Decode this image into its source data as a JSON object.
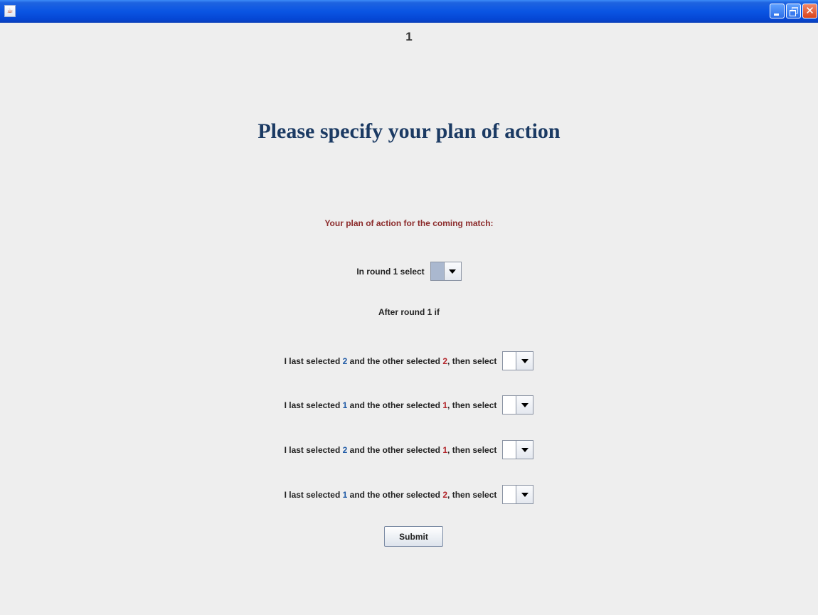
{
  "window": {
    "title": "",
    "icons": {
      "app": "java-cup-icon",
      "minimize": "minimize-icon",
      "maximize": "maximize-icon",
      "close": "close-icon"
    },
    "close_glyph": "✕"
  },
  "header": {
    "round_number": "1",
    "title": "Please specify your plan of action"
  },
  "plan": {
    "subtitle": "Your plan of action for the coming match:",
    "first_round": {
      "label": "In round 1 select",
      "selected_value": ""
    },
    "after_label": "After round 1 if",
    "conditions": [
      {
        "prefix": "I last selected ",
        "my_choice": "2",
        "middle": " and the other selected ",
        "other_choice": "2",
        "suffix": ", then select",
        "selected_value": ""
      },
      {
        "prefix": "I last selected ",
        "my_choice": "1",
        "middle": " and the other selected ",
        "other_choice": "1",
        "suffix": ", then select",
        "selected_value": ""
      },
      {
        "prefix": "I last selected ",
        "my_choice": "2",
        "middle": " and the other selected ",
        "other_choice": "1",
        "suffix": ", then select",
        "selected_value": ""
      },
      {
        "prefix": "I last selected ",
        "my_choice": "1",
        "middle": " and the other selected ",
        "other_choice": "2",
        "suffix": ", then select",
        "selected_value": ""
      }
    ]
  },
  "submit_label": "Submit",
  "colors": {
    "title": "#1b3a63",
    "subtitle": "#8b2a2a",
    "my_choice": "#1f5aa6",
    "other_choice": "#b3262b",
    "titlebar": "#0a55e3"
  }
}
